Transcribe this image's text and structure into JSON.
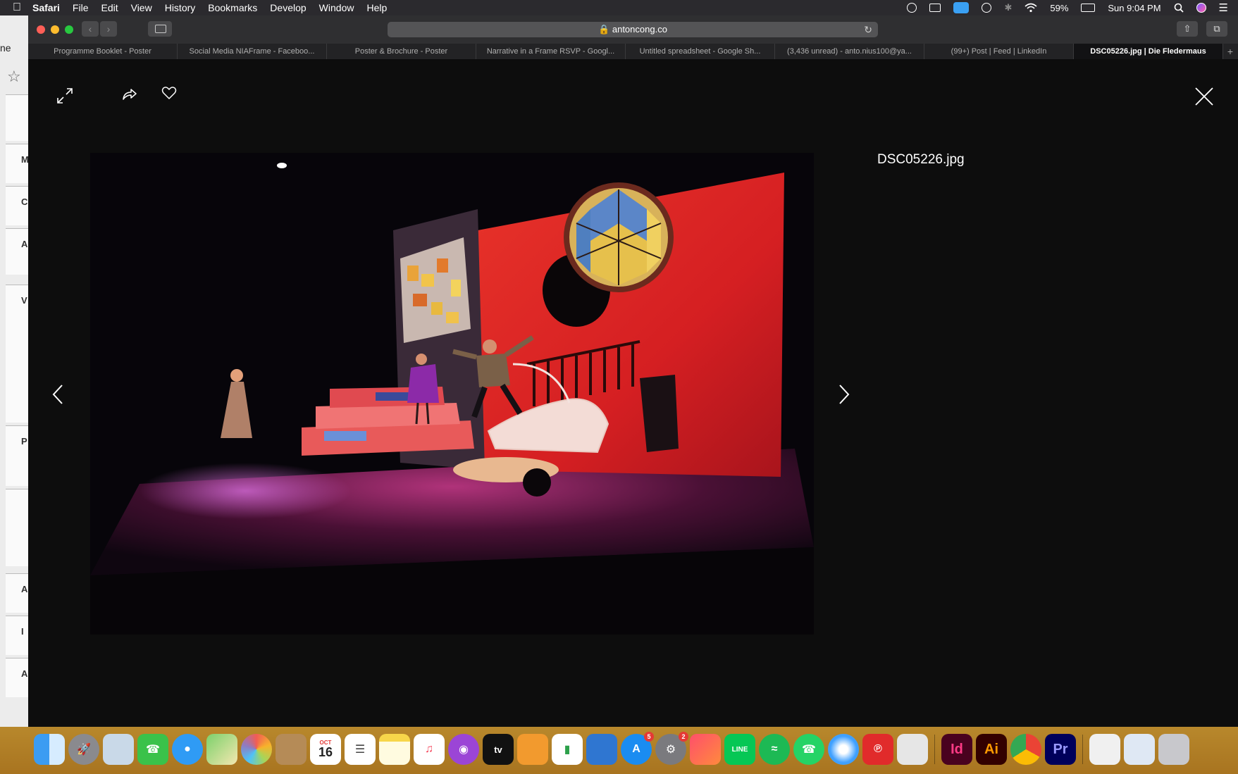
{
  "menubar": {
    "app": "Safari",
    "items": [
      "File",
      "Edit",
      "View",
      "History",
      "Bookmarks",
      "Develop",
      "Window",
      "Help"
    ],
    "battery": "59%",
    "clock": "Sun 9:04 PM"
  },
  "browser": {
    "address": "antoncong.co",
    "tabs": [
      "Programme Booklet - Poster",
      "Social Media NIAFrame - Faceboo...",
      "Poster & Brochure - Poster",
      "Narrative in a Frame RSVP - Googl...",
      "Untitled spreadsheet - Google Sh...",
      "(3,436 unread) - anto.nius100@ya...",
      "(99+) Post | Feed | LinkedIn",
      "DSC05226.jpg | Die Fledermaus"
    ],
    "active_tab": 7,
    "new_tab_glyph": "+"
  },
  "left_strip": {
    "label": "ne",
    "letters": [
      "M",
      "C",
      "A",
      "V",
      "P",
      "A",
      "I",
      "A"
    ]
  },
  "lightbox": {
    "filename": "DSC05226.jpg",
    "icons": {
      "expand": "expand-icon",
      "share": "share-icon",
      "like": "heart-icon",
      "close": "close-icon",
      "prev": "chevron-left-icon",
      "next": "chevron-right-icon"
    }
  },
  "dock": {
    "calendar_month": "OCT",
    "calendar_day": "16",
    "appstore_badge": "5",
    "settings_badge": "2",
    "indesign_label": "Id",
    "illustrator_label": "Ai",
    "premiere_label": "Pr",
    "appletv_label": "tv",
    "line_label": "LINE"
  }
}
